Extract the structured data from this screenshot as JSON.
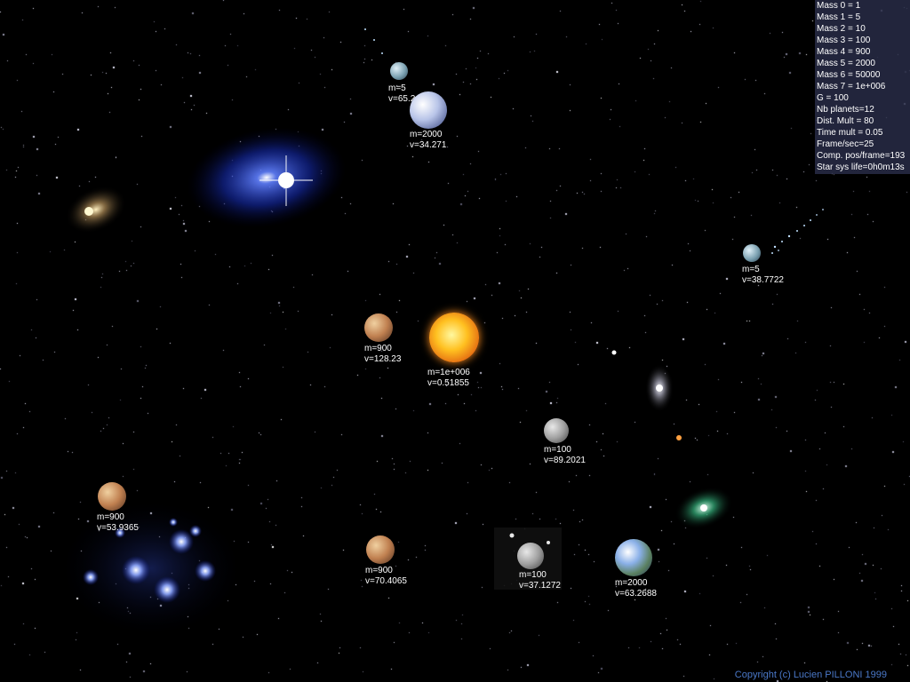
{
  "stats": {
    "lines": [
      "Mass 0 = 1",
      "Mass 1 = 5",
      "Mass 2 = 10",
      "Mass 3 = 100",
      "Mass 4 = 900",
      "Mass 5 = 2000",
      "Mass 6 = 50000",
      "Mass 7 = 1e+006",
      "G = 100",
      "Nb planets=12",
      "Dist. Mult = 80",
      "Time mult = 0.05",
      "Frame/sec=25",
      "Comp. pos/frame=193",
      "Star sys life=0h0m13s"
    ]
  },
  "bodies": [
    {
      "id": "top-small",
      "mass": "m=5",
      "velocity": "v=65.2",
      "color": "#9ab8c8",
      "kind": "small-planet"
    },
    {
      "id": "top-large",
      "mass": "m=2000",
      "velocity": "v=34.271",
      "color": "#b8c4e8",
      "kind": "large-planet"
    },
    {
      "id": "right-small",
      "mass": "m=5",
      "velocity": "v=38.7722",
      "color": "#9ab8c8",
      "kind": "small-planet"
    },
    {
      "id": "center-mars",
      "mass": "m=900",
      "velocity": "v=128.23",
      "color": "#c08050",
      "kind": "rocky-planet"
    },
    {
      "id": "sun",
      "mass": "m=1e+006",
      "velocity": "v=0.51855",
      "color": "#ffb020",
      "kind": "sun"
    },
    {
      "id": "mid-moon",
      "mass": "m=100",
      "velocity": "v=89.2021",
      "color": "#a0a0a0",
      "kind": "moon"
    },
    {
      "id": "left-mars",
      "mass": "m=900",
      "velocity": "v=53.9365",
      "color": "#c08050",
      "kind": "rocky-planet"
    },
    {
      "id": "bottom-mars",
      "mass": "m=900",
      "velocity": "v=70.4065",
      "color": "#c08050",
      "kind": "rocky-planet"
    },
    {
      "id": "bottom-moon",
      "mass": "m=100",
      "velocity": "v=37.1272",
      "color": "#a0a0a0",
      "kind": "moon"
    },
    {
      "id": "bottom-earth",
      "mass": "m=2000",
      "velocity": "v=63.2688",
      "color": "#6a9ad8",
      "kind": "large-planet"
    }
  ],
  "copyright": "Copyright (c) Lucien PILLONI 1999",
  "colors": {
    "background": "#000000",
    "stats_panel": "#282c46",
    "copyright": "#4a78c8",
    "label": "#ffffff"
  }
}
